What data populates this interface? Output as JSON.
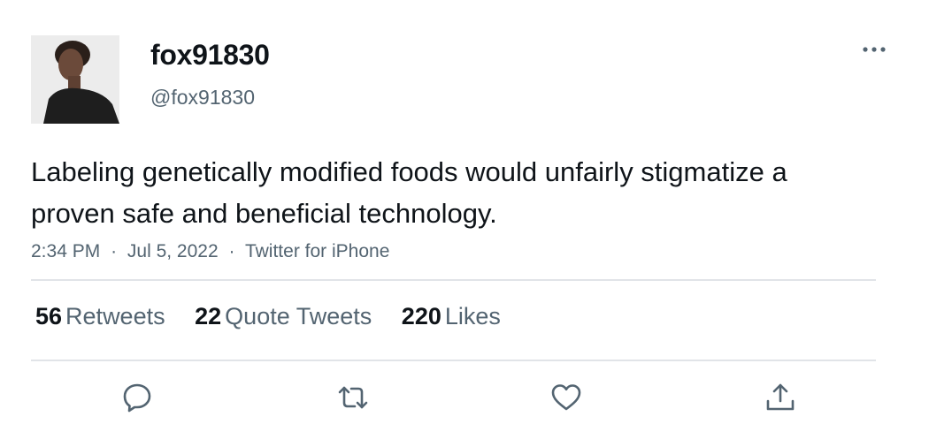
{
  "user": {
    "display_name": "fox91830",
    "handle": "@fox91830",
    "avatar_icon": "profile-photo"
  },
  "tweet": {
    "text": "Labeling genetically modified foods would unfairly stigmatize a proven safe and beneficial technology.",
    "time": "2:34 PM",
    "date": "Jul 5, 2022",
    "source": "Twitter for iPhone",
    "separator": "·"
  },
  "stats": {
    "retweets_count": "56",
    "retweets_label": "Retweets",
    "quotes_count": "22",
    "quotes_label": "Quote Tweets",
    "likes_count": "220",
    "likes_label": "Likes"
  },
  "actions": [
    {
      "name": "reply",
      "icon": "reply-icon"
    },
    {
      "name": "retweet",
      "icon": "retweet-icon"
    },
    {
      "name": "like",
      "icon": "heart-icon"
    },
    {
      "name": "share",
      "icon": "share-icon"
    }
  ],
  "colors": {
    "primary_text": "#0f1419",
    "secondary_text": "#536471",
    "divider": "#e1e4e8",
    "icon": "#536471"
  }
}
